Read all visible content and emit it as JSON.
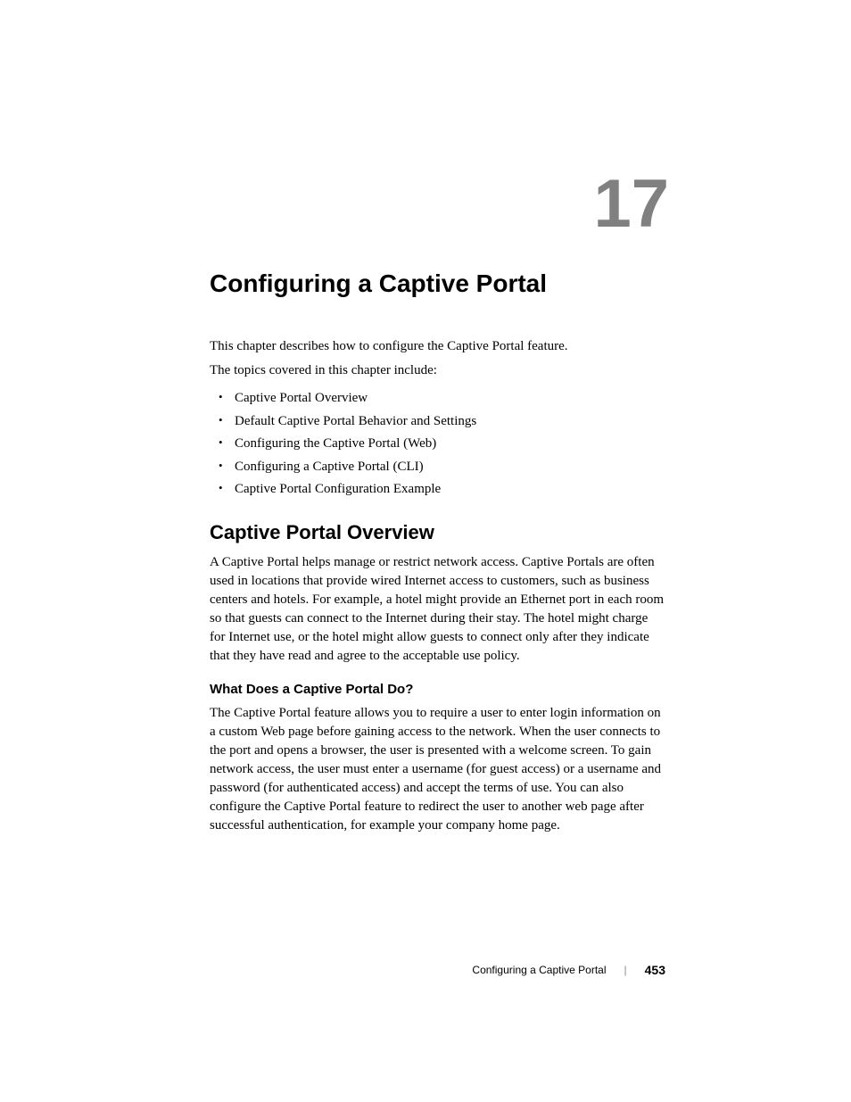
{
  "chapter": {
    "number": "17",
    "title": "Configuring a Captive Portal"
  },
  "intro1": "This chapter describes how to configure the Captive Portal feature.",
  "intro2": "The topics covered in this chapter include:",
  "topics": [
    "Captive Portal Overview",
    "Default Captive Portal Behavior and Settings",
    "Configuring the Captive Portal (Web)",
    "Configuring a Captive Portal (CLI)",
    "Captive Portal Configuration Example"
  ],
  "section1": {
    "heading": "Captive Portal Overview",
    "body": "A Captive Portal helps manage or restrict network access. Captive Portals are often used in locations that provide wired Internet access to customers, such as business centers and hotels. For example, a hotel might provide an Ethernet port in each room so that guests can connect to the Internet during their stay. The hotel might charge for Internet use, or the hotel might allow guests to connect only after they indicate that they have read and agree to the acceptable use policy."
  },
  "subsection1": {
    "heading": "What Does a Captive Portal Do?",
    "body": "The Captive Portal feature allows you to require a user to enter login information on a custom Web page before gaining access to the network. When the user connects to the port and opens a browser, the user is presented with a welcome screen. To gain network access, the user must enter a username (for guest access) or a username and password (for authenticated access) and accept the terms of use. You can also configure the Captive Portal feature to redirect the user to another web page after successful authentication, for example your company home page."
  },
  "footer": {
    "text": "Configuring a Captive Portal",
    "page": "453"
  }
}
